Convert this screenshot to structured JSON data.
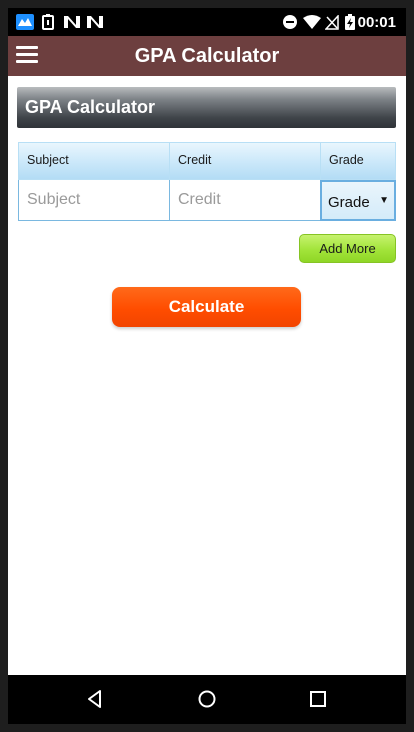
{
  "status_bar": {
    "time": "00:01",
    "icons": [
      "app-logo-icon",
      "battery-saver-icon",
      "notification-n-icon",
      "notification-n-icon",
      "do-not-disturb-icon",
      "wifi-icon",
      "no-signal-icon",
      "battery-charging-icon"
    ]
  },
  "app_bar": {
    "title": "GPA Calculator",
    "menu_icon": "hamburger-menu-icon",
    "background": "#6d3f3f"
  },
  "section": {
    "title": "GPA Calculator"
  },
  "table": {
    "headers": [
      "Subject",
      "Credit",
      "Grade"
    ],
    "row": {
      "subject_placeholder": "Subject",
      "subject_value": "",
      "credit_placeholder": "Credit",
      "credit_value": "",
      "grade_selected": "Grade"
    }
  },
  "buttons": {
    "add_more": "Add More",
    "calculate": "Calculate"
  },
  "colors": {
    "add_more": "#a2e43a",
    "calculate": "#ff4d00",
    "header_border": "#7ab8e0"
  },
  "nav_bar": {
    "icons": [
      "back-icon",
      "home-icon",
      "recents-icon"
    ]
  }
}
